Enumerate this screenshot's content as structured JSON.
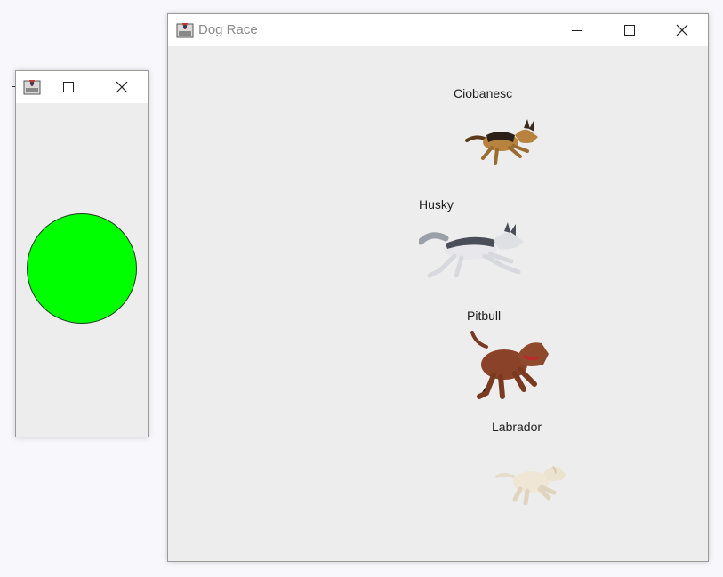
{
  "small_window": {
    "icons": {
      "app": "java-app-icon",
      "maximize": "maximize-icon",
      "close": "close-icon"
    },
    "ball": {
      "color": "#00ff00",
      "shape": "circle"
    }
  },
  "main_window": {
    "title": "Dog Race",
    "icons": {
      "app": "java-app-icon",
      "minimize": "minimize-icon",
      "maximize": "maximize-icon",
      "close": "close-icon"
    },
    "dogs": [
      {
        "name": "Ciobanesc",
        "image": "german-shepherd-running"
      },
      {
        "name": "Husky",
        "image": "husky-running"
      },
      {
        "name": "Pitbull",
        "image": "pitbull-running"
      },
      {
        "name": "Labrador",
        "image": "labrador-running"
      }
    ]
  },
  "colors": {
    "window_bg": "#ededed",
    "titlebar_bg": "#ffffff",
    "title_text": "#8a8a8a"
  }
}
